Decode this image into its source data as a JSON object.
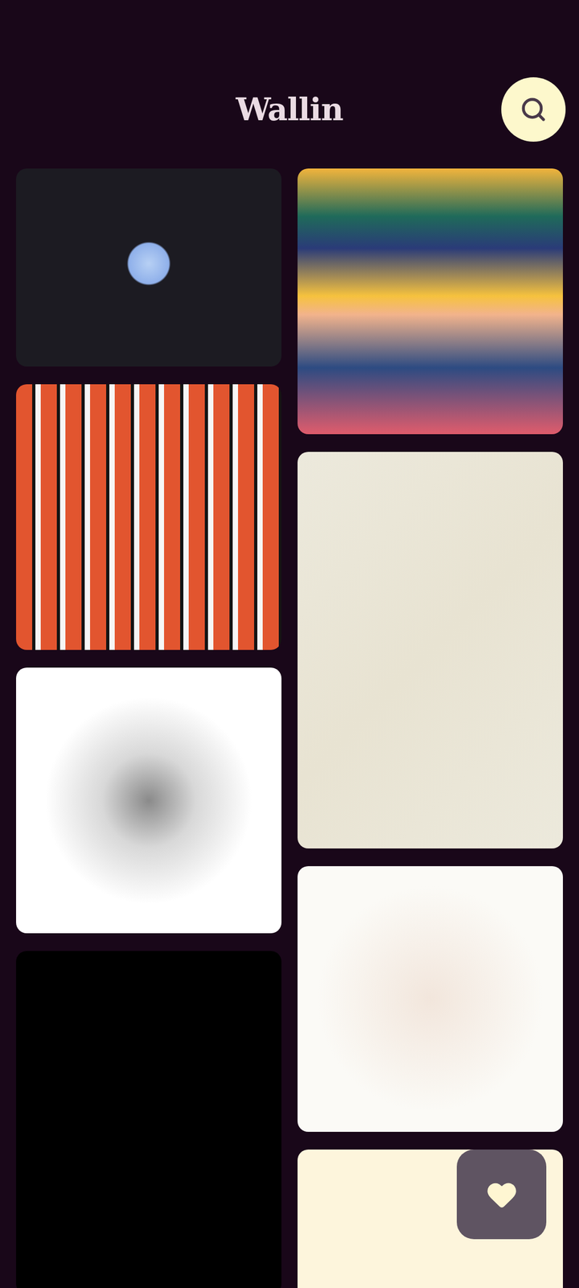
{
  "app": {
    "title": "Wallin"
  },
  "search_button": {
    "label": "Search"
  },
  "favorites_button": {
    "label": "Favorites"
  },
  "gallery": {
    "left": [
      {
        "kind": "image"
      },
      {
        "kind": "image"
      },
      {
        "kind": "image"
      },
      {
        "kind": "image"
      }
    ],
    "right": [
      {
        "kind": "image"
      },
      {
        "kind": "image"
      },
      {
        "kind": "image"
      },
      {
        "kind": "image"
      }
    ]
  }
}
